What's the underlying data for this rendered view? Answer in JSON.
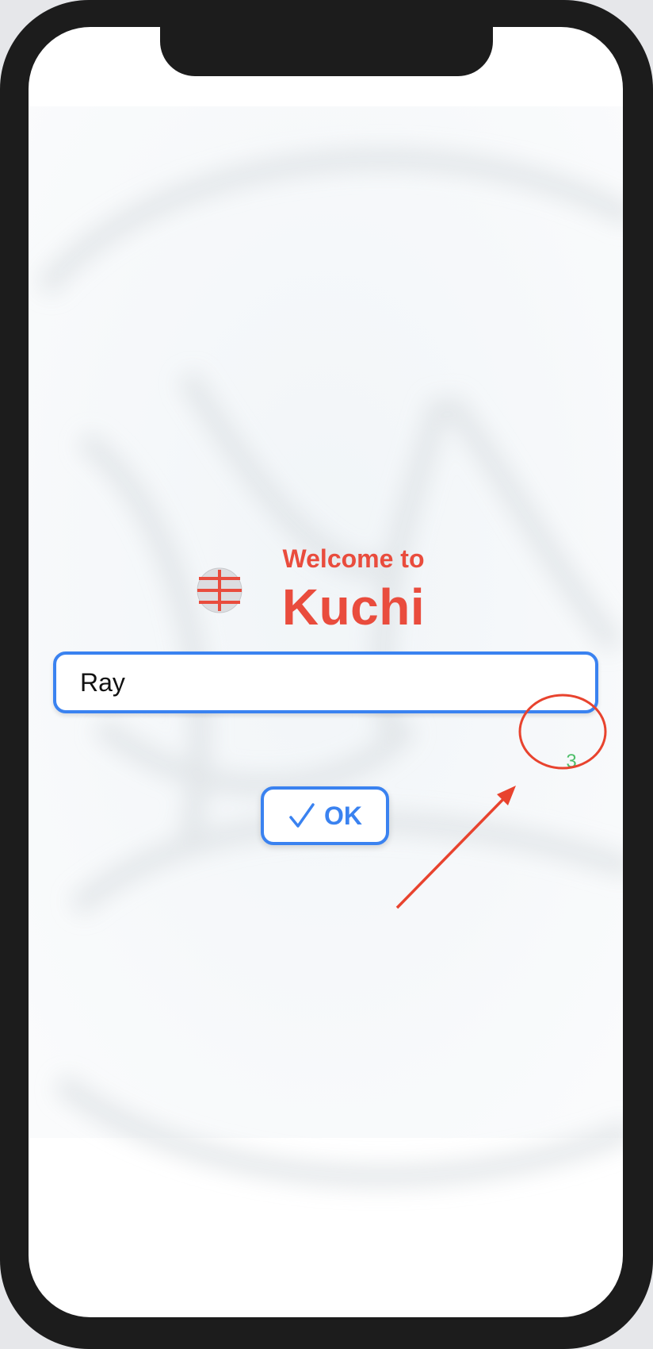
{
  "welcome": {
    "subtitle": "Welcome to",
    "title": "Kuchi"
  },
  "name_field": {
    "value": "Ray",
    "placeholder": ""
  },
  "char_counter": "3",
  "ok_button": {
    "label": "OK"
  },
  "icons": {
    "logo": "kuchi-logo-icon",
    "ok": "checkmark-icon"
  },
  "colors": {
    "accent": "#3a82f0",
    "brand": "#e94c3d",
    "counter": "#4fbf6a",
    "annotation": "#e8432e"
  }
}
